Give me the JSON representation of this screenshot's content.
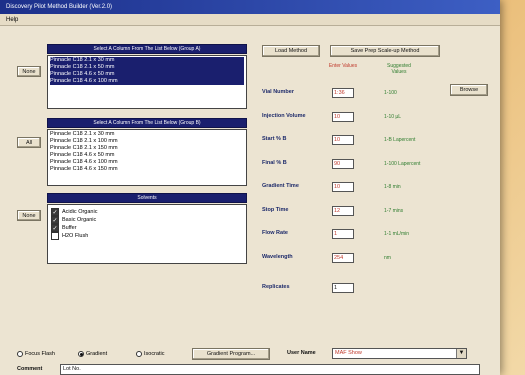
{
  "window": {
    "title": "Discovery Pilot Method Builder (Ver.2.0)"
  },
  "menu": {
    "help": "Help"
  },
  "buttons": {
    "load_method": "Load Method",
    "save_prep": "Save Prep Scale-up Method",
    "browse": "Browse",
    "none_1": "None",
    "all": "All",
    "none_2": "None",
    "gradient_program": "Gradient Program..."
  },
  "group_a": {
    "header": "Select A Column From The List Below (Group A)",
    "items": [
      "Pinnacle C18 2.1 x 30 mm",
      "Pinnacle C18 2.1 x 50 mm",
      "Pinnacle C18 4.6 x 50 mm",
      "Pinnacle C18 4.6 x 100 mm"
    ]
  },
  "group_b": {
    "header": "Select A Column From The List Below (Group B)",
    "items": [
      "Pinnacle C18 2.1 x 30 mm",
      "Pinnacle C18 2.1 x 100 mm",
      "Pinnacle C18 2.1 x 150 mm",
      "Pinnacle C18 4.6 x 50 mm",
      "Pinnacle C18 4.6 x 100 mm",
      "Pinnacle C18 4.6 x 150 mm"
    ]
  },
  "solvents": {
    "header": "Solvents",
    "items": [
      {
        "label": "Acidic Organic",
        "checked": true
      },
      {
        "label": "Basic Organic",
        "checked": true
      },
      {
        "label": "Buffer",
        "checked": true
      },
      {
        "label": "H2O Flush",
        "checked": false
      }
    ]
  },
  "columns": {
    "enter": "Enter Values",
    "suggested": "Suggested Values"
  },
  "params": [
    {
      "label": "Vial Number",
      "value": "1:36",
      "suggested": "1-100"
    },
    {
      "label": "Injection Volume",
      "value": "10",
      "suggested": "1-10 µL"
    },
    {
      "label": "Start % B",
      "value": "10",
      "suggested": "1-B Lapercent"
    },
    {
      "label": "Final % B",
      "value": "90",
      "suggested": "1-100 Lapercent"
    },
    {
      "label": "Gradient Time",
      "value": "10",
      "suggested": "1-8 min"
    },
    {
      "label": "Stop Time",
      "value": "12",
      "suggested": "1-7 mins"
    },
    {
      "label": "Flow Rate",
      "value": "1",
      "suggested": "1-1 mL/min"
    },
    {
      "label": "Wavelength",
      "value": "254",
      "suggested": "nm"
    }
  ],
  "replicates": {
    "label": "Replicates",
    "value": "1"
  },
  "mode": {
    "options": [
      {
        "label": "Focus Flash",
        "selected": false
      },
      {
        "label": "Gradient",
        "selected": true
      },
      {
        "label": "Isocratic",
        "selected": false
      }
    ]
  },
  "user": {
    "label": "User Name",
    "value": "MAF Show"
  },
  "comment": {
    "label": "Comment",
    "value": "Lot No."
  }
}
